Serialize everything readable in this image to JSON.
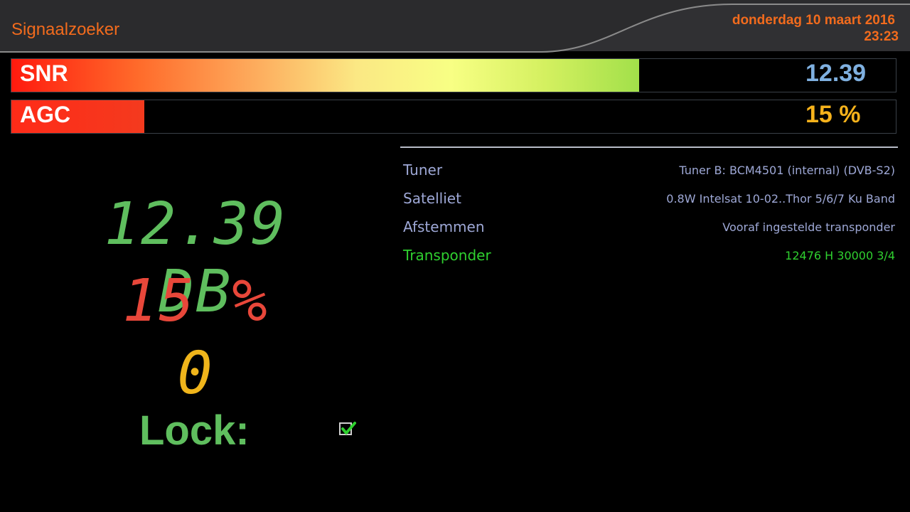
{
  "header": {
    "title": "Signaalzoeker",
    "date": "donderdag 10 maart 2016",
    "time": "23:23"
  },
  "bars": {
    "snr": {
      "label": "SNR",
      "value": "12.39",
      "fill_fraction": 0.71
    },
    "agc": {
      "label": "AGC",
      "value": "15 %",
      "fill_fraction": 0.15
    }
  },
  "readouts": {
    "snr_db": "12.39 DB",
    "agc_percent": "15 %",
    "ber": "0",
    "lock_label": "Lock:",
    "locked": true
  },
  "info": {
    "rows": [
      {
        "label": "Tuner",
        "value": "Tuner B: BCM4501 (internal) (DVB-S2)"
      },
      {
        "label": "Satelliet",
        "value": "0.8W Intelsat 10-02..Thor 5/6/7 Ku Band"
      },
      {
        "label": "Afstemmen",
        "value": "Vooraf ingestelde transponder"
      },
      {
        "label": "Transponder",
        "value": "12476 H 30000 3/4"
      }
    ]
  },
  "colors": {
    "accent": "#f26b1d",
    "snr_value": "#7fb0e0",
    "agc_value": "#f6b21b",
    "info_text": "#9ea8d6",
    "active_row": "#2fd02f",
    "lcd_green": "#5fbe5e",
    "lcd_red": "#e8473a",
    "lcd_yellow": "#f0b51b"
  }
}
